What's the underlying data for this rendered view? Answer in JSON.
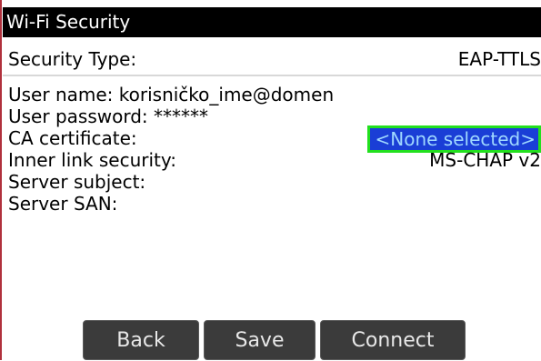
{
  "title": "Wi-Fi Security",
  "security_type": {
    "label": "Security Type:",
    "value": "EAP-TTLS"
  },
  "fields": {
    "user_name": "User name: korisničko_ime@domen",
    "user_password": "User password: ******",
    "ca_certificate": {
      "label": "CA certificate:",
      "value": "<None selected>"
    },
    "inner_link_security": {
      "label": "Inner link security:",
      "value": "MS-CHAP v2"
    },
    "server_subject": "Server subject:",
    "server_san": "Server SAN:"
  },
  "buttons": {
    "back": "Back",
    "save": "Save",
    "connect": "Connect"
  },
  "colors": {
    "title_bg": "#000000",
    "selection_bg": "#1a3ed6",
    "selection_border": "#22e01e",
    "button_bg": "#3b3b3b"
  }
}
